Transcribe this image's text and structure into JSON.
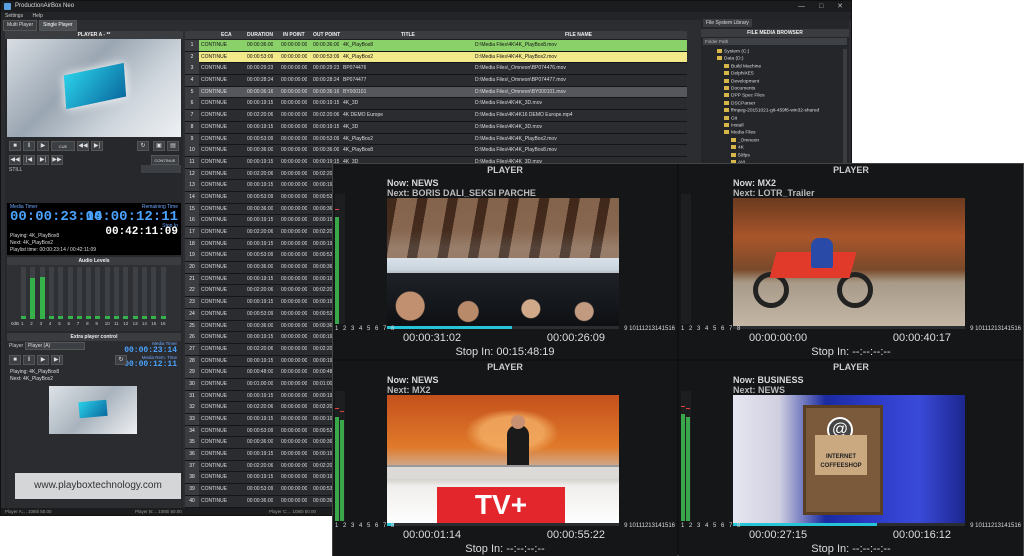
{
  "window": {
    "title": "ProductionAirBox Neo",
    "controls": [
      "—",
      "□",
      "✕"
    ]
  },
  "menu": [
    "Settings",
    "Help"
  ],
  "mode_tabs": [
    "Multi Player",
    "Single Player"
  ],
  "player_panel": {
    "title": "PLAYER A - **",
    "continue_label": "CONTINUE",
    "still_label": "STILL",
    "cue_label": "CUE",
    "media_timer_label": "Media Timer",
    "media_timer": "00:00:23:14",
    "remaining_label": "Remaining Time",
    "remaining": "00:00:12:11",
    "stop_in_label": "Stop In",
    "stop_in": "00:42:11:09",
    "playing": "Playing: 4K_PlayBox8",
    "next": "Next: 4K_PlayBox2",
    "playlist_time": "Playlist time: 00:00:23:14 / 00:42:11:09"
  },
  "audio": {
    "title": "Audio Levels",
    "db_label": "0dB",
    "channels": [
      "1",
      "2",
      "3",
      "4",
      "5",
      "6",
      "7",
      "8",
      "9",
      "10",
      "11",
      "12",
      "13",
      "14",
      "15",
      "16"
    ],
    "levels": [
      0.05,
      0.78,
      0.8,
      0.05,
      0.05,
      0.05,
      0.05,
      0.05,
      0.05,
      0.05,
      0.05,
      0.05,
      0.05,
      0.05,
      0.05,
      0.05
    ]
  },
  "extra": {
    "title": "Extra player control",
    "player_label": "Player",
    "player_value": "Player (A)",
    "media_timer_label": "Media Timer",
    "media_timer": "00:00:23:14",
    "remaining_label": "Media Rem. Time",
    "remaining": "00:00:12:11",
    "playing": "Playing: 4K_PlayBox8",
    "next": "Next: 4K_PlayBox2",
    "website": "www.playboxtechnology.com"
  },
  "playlist": {
    "columns": [
      "ECA",
      "DURATION",
      "IN POINT",
      "OUT POINT",
      "TITLE",
      "FILE NAME"
    ],
    "rows": [
      [
        "1",
        "CONTINUE",
        "00:00:36:00",
        "00:00:00:00",
        "00:00:36:00",
        "4K_PlayBox8",
        "D:\\Media Files\\4K\\4K_PlayBox8.mov"
      ],
      [
        "2",
        "CONTINUE",
        "00:00:53:09",
        "00:00:00:00",
        "00:00:53:09",
        "4K_PlayBox2",
        "D:\\Media Files\\4K\\4K_PlayBox2.mov"
      ],
      [
        "3",
        "CONTINUE",
        "00:00:29:23",
        "00:00:00:00",
        "00:00:29:23",
        "BP074476",
        "D:\\Media Files\\_Omneon\\BP074476.mov"
      ],
      [
        "4",
        "CONTINUE",
        "00:00:28:24",
        "00:00:00:00",
        "00:00:28:24",
        "BP074477",
        "D:\\Media Files\\_Omneon\\BP074477.mov"
      ],
      [
        "5",
        "CONTINUE",
        "00:00:36:16",
        "00:00:00:00",
        "00:00:36:16",
        "BY000101",
        "D:\\Media Files\\_Omneon\\BY000101.mov"
      ],
      [
        "6",
        "CONTINUE",
        "00:00:19:15",
        "00:00:00:00",
        "00:00:19:15",
        "4K_3D",
        "D:\\Media Files\\4K\\4K_3D.mov"
      ],
      [
        "7",
        "CONTINUE",
        "00:02:20:06",
        "00:00:00:00",
        "00:02:20:06",
        "4K DEMO Europe",
        "D:\\Media Files\\4K\\4K16 DEMO Europe.mp4"
      ],
      [
        "8",
        "CONTINUE",
        "00:00:19:15",
        "00:00:00:00",
        "00:00:19:15",
        "4K_3D",
        "D:\\Media Files\\4K\\4K_3D.mov"
      ],
      [
        "9",
        "CONTINUE",
        "00:00:53:09",
        "00:00:00:00",
        "00:00:53:09",
        "4K_PlayBox2",
        "D:\\Media Files\\4K\\4K_PlayBox2.mov"
      ],
      [
        "10",
        "CONTINUE",
        "00:00:36:00",
        "00:00:00:00",
        "00:00:36:00",
        "4K_PlayBox8",
        "D:\\Media Files\\4K\\4K_PlayBox8.mov"
      ],
      [
        "11",
        "CONTINUE",
        "00:00:19:15",
        "00:00:00:00",
        "00:00:19:15",
        "4K_3D",
        "D:\\Media Files\\4K\\4K_3D.mov"
      ],
      [
        "12",
        "CONTINUE",
        "00:02:20:06",
        "00:00:00:00",
        "00:02:20",
        "",
        ""
      ],
      [
        "13",
        "CONTINUE",
        "00:00:19:15",
        "00:00:00:00",
        "00:00:19",
        "",
        ""
      ],
      [
        "14",
        "CONTINUE",
        "00:00:53:09",
        "00:00:00:00",
        "00:00:53",
        "",
        ""
      ],
      [
        "15",
        "CONTINUE",
        "00:00:36:00",
        "00:00:00:00",
        "00:00:36",
        "",
        ""
      ],
      [
        "16",
        "CONTINUE",
        "00:00:19:15",
        "00:00:00:00",
        "00:00:19",
        "",
        ""
      ],
      [
        "17",
        "CONTINUE",
        "00:02:20:06",
        "00:00:00:00",
        "00:02:20",
        "",
        ""
      ],
      [
        "18",
        "CONTINUE",
        "00:00:19:15",
        "00:00:00:00",
        "00:00:19",
        "",
        ""
      ],
      [
        "19",
        "CONTINUE",
        "00:00:53:09",
        "00:00:00:00",
        "00:00:53",
        "",
        ""
      ],
      [
        "20",
        "CONTINUE",
        "00:00:36:00",
        "00:00:00:00",
        "00:00:36",
        "",
        ""
      ],
      [
        "21",
        "CONTINUE",
        "00:00:19:15",
        "00:00:00:00",
        "00:00:19",
        "",
        ""
      ],
      [
        "22",
        "CONTINUE",
        "00:02:20:06",
        "00:00:00:00",
        "00:02:20",
        "",
        ""
      ],
      [
        "23",
        "CONTINUE",
        "00:00:19:15",
        "00:00:00:00",
        "00:00:19",
        "",
        ""
      ],
      [
        "24",
        "CONTINUE",
        "00:00:53:09",
        "00:00:00:00",
        "00:00:53",
        "",
        ""
      ],
      [
        "25",
        "CONTINUE",
        "00:00:36:00",
        "00:00:00:00",
        "00:00:36",
        "",
        ""
      ],
      [
        "26",
        "CONTINUE",
        "00:00:19:15",
        "00:00:00:00",
        "00:00:19",
        "",
        ""
      ],
      [
        "27",
        "CONTINUE",
        "00:02:20:06",
        "00:00:00:00",
        "00:02:20",
        "",
        ""
      ],
      [
        "28",
        "CONTINUE",
        "00:00:19:15",
        "00:00:00:00",
        "00:00:19",
        "",
        ""
      ],
      [
        "29",
        "CONTINUE",
        "00:00:48:00",
        "00:00:00:00",
        "00:00:48",
        "",
        ""
      ],
      [
        "30",
        "CONTINUE",
        "00:01:00:00",
        "00:00:00:00",
        "00:01:00",
        "",
        ""
      ],
      [
        "31",
        "CONTINUE",
        "00:00:19:15",
        "00:00:00:00",
        "00:00:19",
        "",
        ""
      ],
      [
        "32",
        "CONTINUE",
        "00:02:20:06",
        "00:00:00:00",
        "00:02:20",
        "",
        ""
      ],
      [
        "33",
        "CONTINUE",
        "00:00:19:15",
        "00:00:00:00",
        "00:00:19",
        "",
        ""
      ],
      [
        "34",
        "CONTINUE",
        "00:00:53:09",
        "00:00:00:00",
        "00:00:53",
        "",
        ""
      ],
      [
        "35",
        "CONTINUE",
        "00:00:36:00",
        "00:00:00:00",
        "00:00:36",
        "",
        ""
      ],
      [
        "36",
        "CONTINUE",
        "00:00:19:15",
        "00:00:00:00",
        "00:00:19",
        "",
        ""
      ],
      [
        "37",
        "CONTINUE",
        "00:02:20:06",
        "00:00:00:00",
        "00:02:20",
        "",
        ""
      ],
      [
        "38",
        "CONTINUE",
        "00:00:19:15",
        "00:00:00:00",
        "00:00:19",
        "",
        ""
      ],
      [
        "39",
        "CONTINUE",
        "00:00:53:09",
        "00:00:00:00",
        "00:00:53",
        "",
        ""
      ],
      [
        "40",
        "CONTINUE",
        "00:00:36:00",
        "00:00:00:00",
        "00:00:36",
        "",
        ""
      ]
    ]
  },
  "browser": {
    "tab": "File System Library",
    "title": "FILE MEDIA BROWSER",
    "path": "Folder Path",
    "tree": [
      {
        "label": "System (C:)",
        "indent": 0
      },
      {
        "label": "Data (D:)",
        "indent": 0
      },
      {
        "label": "Build Machine",
        "indent": 1
      },
      {
        "label": "DelphiXE5",
        "indent": 1
      },
      {
        "label": "Development",
        "indent": 1
      },
      {
        "label": "Documents",
        "indent": 1
      },
      {
        "label": "DPP Spec Files",
        "indent": 1
      },
      {
        "label": "DSCParser",
        "indent": 1
      },
      {
        "label": "ffmpeg-20151021-git-459f6-win32-shared",
        "indent": 1
      },
      {
        "label": "Git",
        "indent": 1
      },
      {
        "label": "Install",
        "indent": 1
      },
      {
        "label": "Media Files",
        "indent": 1
      },
      {
        "label": "_Omneon",
        "indent": 2
      },
      {
        "label": "4K",
        "indent": 2
      },
      {
        "label": "50fps",
        "indent": 2
      },
      {
        "label": "AVI",
        "indent": 2
      },
      {
        "label": "CC",
        "indent": 2
      },
      {
        "label": "DATA",
        "indent": 2
      }
    ]
  },
  "statusbar": [
    "Player A:... 1080i 50.00",
    "Player B:... 1080i 50.00",
    "Player C:... 1080i 50.00"
  ],
  "multiview": {
    "quads": [
      {
        "title": "PLAYER",
        "now": "Now: NEWS",
        "next": "Next: BORIS DALI_SEKSI PARCHE",
        "elapsed": "00:00:31:02",
        "remaining": "00:00:26:09",
        "stop_in": "Stop In: 00:15:48:19",
        "progress": 0.54,
        "levels": [
          0.82,
          0.0,
          0.0,
          0.0,
          0.0,
          0.0,
          0.0,
          0.0
        ],
        "ch_left": "1 2 3 4 5 6 7 8",
        "ch_right": "9 10111213141516"
      },
      {
        "title": "PLAYER",
        "now": "Now: MX2",
        "next": "Next: LOTR_Trailer",
        "elapsed": "00:00:00:00",
        "remaining": "00:00:40:17",
        "stop_in": "Stop In: --:--:--:--",
        "progress": 0.0,
        "levels": [
          0,
          0,
          0,
          0,
          0,
          0,
          0,
          0
        ],
        "ch_left": "1 2 3 4 5 6 7 8",
        "ch_right": "9 10111213141516"
      },
      {
        "title": "PLAYER",
        "now": "Now: NEWS",
        "next": "Next: MX2",
        "elapsed": "00:00:01:14",
        "remaining": "00:00:55:22",
        "stop_in": "Stop In: --:--:--:--",
        "progress": 0.03,
        "levels": [
          0.8,
          0.78,
          0,
          0,
          0,
          0,
          0,
          0
        ],
        "tv_logo": "TV+",
        "ch_left": "1 2 3 4 5 6 7 8",
        "ch_right": "9 10111213141516"
      },
      {
        "title": "PLAYER",
        "now": "Now: BUSINESS",
        "next": "Next: NEWS",
        "elapsed": "00:00:27:15",
        "remaining": "00:00:16:12",
        "stop_in": "Stop In: --:--:--:--",
        "progress": 0.62,
        "levels": [
          0.82,
          0.8,
          0,
          0,
          0,
          0,
          0,
          0
        ],
        "shop_sign": "INTERNET COFFEESHOP",
        "ch_left": "1 2 3 4 5 6 7 8",
        "ch_right": "9 10111213141516"
      }
    ]
  },
  "colors": {
    "accent_blue": "#4aa3ff",
    "meter_green": "#36b24a",
    "progress_cyan": "#27c3d6",
    "row_playing": "#8ad16a",
    "row_next": "#f2e98a"
  }
}
